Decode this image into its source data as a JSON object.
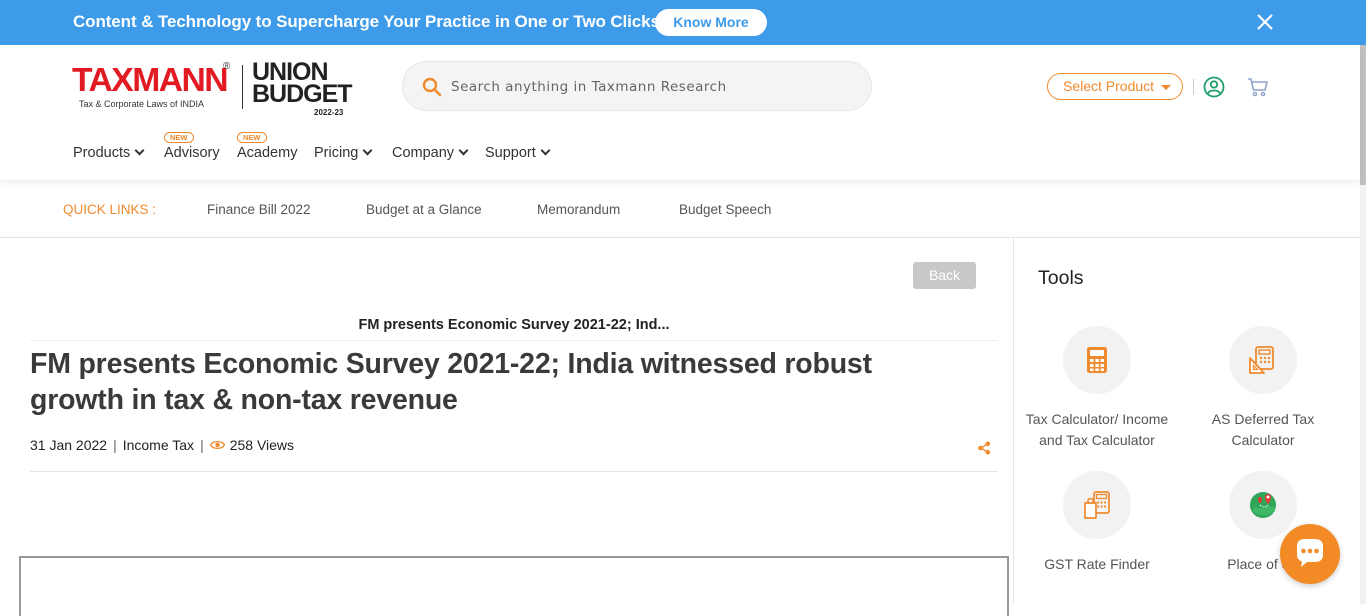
{
  "promo": {
    "text": "Content & Technology to Supercharge Your Practice in One or Two Clicks.",
    "button_label": "Know More",
    "color": "#3d9be9"
  },
  "brand": {
    "logo_text": "TAXMANN",
    "logo_mark": "®",
    "tagline": "Tax & Corporate Laws of INDIA",
    "budget_line1": "UNION",
    "budget_line2": "BUDGET",
    "budget_year": "2022-23",
    "brand_red": "#e21b23",
    "accent_orange": "#f08a2e"
  },
  "search": {
    "placeholder": "Search anything in Taxmann Research",
    "icon": "search-icon"
  },
  "header_actions": {
    "select_product_label": "Select Product",
    "user_icon": "user-circle-icon",
    "cart_icon": "cart-icon"
  },
  "nav": {
    "products": "Products",
    "advisory": "Advisory",
    "academy": "Academy",
    "pricing": "Pricing",
    "company": "Company",
    "support": "Support",
    "new_badge": "NEW"
  },
  "quick_links": {
    "label": "QUICK LINKS :",
    "items": [
      "Finance Bill 2022",
      "Budget at a Glance",
      "Memorandum",
      "Budget Speech"
    ]
  },
  "article": {
    "back_label": "Back",
    "breadcrumb_title": "FM presents Economic Survey 2021-22; Ind...",
    "title": "FM presents Economic Survey 2021-22; India witnessed robust growth in tax & non-tax revenue",
    "date": "31 Jan 2022",
    "category": "Income Tax",
    "views": "258 Views",
    "separator": "|"
  },
  "sidebar": {
    "title": "Tools",
    "tools": [
      {
        "label": "Tax Calculator/ Income and Tax Calculator",
        "icon": "calculator-icon"
      },
      {
        "label": "AS Deferred Tax Calculator",
        "icon": "deferred-tax-icon"
      },
      {
        "label": "GST Rate Finder",
        "icon": "gst-finder-icon"
      },
      {
        "label": "Place of Su",
        "icon": "map-pin-icon"
      }
    ]
  }
}
